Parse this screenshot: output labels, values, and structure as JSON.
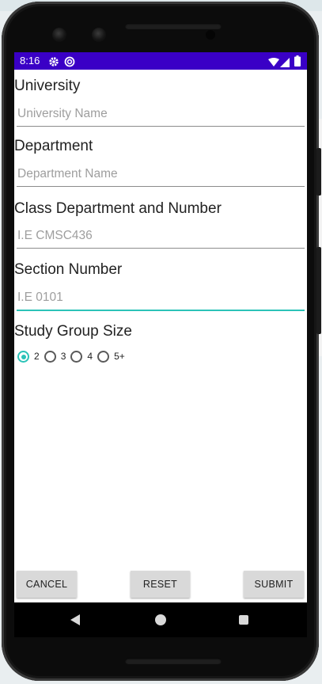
{
  "status_bar": {
    "time": "8:16",
    "icons": [
      "gear-icon",
      "sync-icon",
      "wifi-icon",
      "signal-icon",
      "battery-icon"
    ],
    "color": "#3a00c6"
  },
  "form": {
    "university": {
      "label": "University",
      "placeholder": "University Name",
      "value": ""
    },
    "department": {
      "label": "Department",
      "placeholder": "Department Name",
      "value": ""
    },
    "class": {
      "label": "Class Department and Number",
      "placeholder": "I.E CMSC436",
      "value": ""
    },
    "section": {
      "label": "Section Number",
      "placeholder": "I.E 0101",
      "value": ""
    },
    "group_size": {
      "label": "Study Group Size",
      "options": [
        "2",
        "3",
        "4",
        "5+"
      ],
      "selected": "2"
    }
  },
  "buttons": {
    "cancel": "CANCEL",
    "reset": "RESET",
    "submit": "SUBMIT"
  },
  "nav_bar": {
    "icons": [
      "back-icon",
      "home-icon",
      "recents-icon"
    ]
  },
  "colors": {
    "accent": "#2bc3b8",
    "status_bar": "#3a00c6",
    "button": "#d9d9d9"
  }
}
